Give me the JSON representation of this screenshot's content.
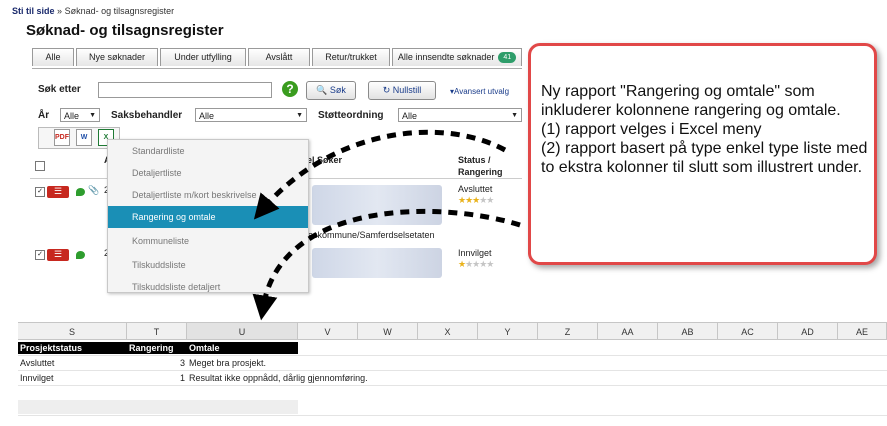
{
  "breadcrumb": {
    "label": "Sti til side",
    "separator": "»",
    "current": "Søknad- og tilsagnsregister"
  },
  "page_title": "Søknad- og tilsagnsregister",
  "tabs": [
    {
      "label": "Alle"
    },
    {
      "label": "Nye søknader"
    },
    {
      "label": "Under utfylling"
    },
    {
      "label": "Avslått"
    },
    {
      "label": "Retur/trukket"
    },
    {
      "label": "Alle innsendte søknader",
      "badge": "41"
    }
  ],
  "search": {
    "label": "Søk etter",
    "value": "",
    "help_icon": "question-icon",
    "search_button": "Søk",
    "reset_button": "Nullstill",
    "advanced_link": "▾Avansert utvalg"
  },
  "filters": {
    "year_label": "År",
    "year_value": "Alle",
    "caseworker_label": "Saksbehandler",
    "caseworker_value": "Alle",
    "support_label": "Støtteordning",
    "support_value": "Alle"
  },
  "export_icons": [
    "pdf-icon",
    "word-icon",
    "excel-icon"
  ],
  "table": {
    "col_a": "A",
    "col_soker": "el Søker",
    "col_status": "Status /",
    "col_rangering": "Rangering",
    "row1_status": "Avsluttet",
    "row1_stars": 3,
    "row1_sub": "eskommune/Samferdselsetaten",
    "row2_status": "Innvilget",
    "row2_stars": 1,
    "row1_id": "2",
    "row2_id": "2"
  },
  "menu": {
    "items": [
      "Standardliste",
      "Detaljertliste",
      "Detaljertliste m/kort beskrivelse",
      "Rangering og omtale",
      "Kommuneliste",
      "Tilskuddsliste",
      "Tilskuddsliste detaljert"
    ],
    "selected_index": 3
  },
  "callout": {
    "text": "Ny rapport \"Rangering og omtale\" som inkluderer kolonnene rangering og omtale.\n(1) rapport velges i Excel meny\n(2) rapport basert på type enkel type liste med to ekstra kolonner til slutt som illustrert under.",
    "border_color": "#e14848"
  },
  "spreadsheet": {
    "columns": [
      "S",
      "T",
      "U",
      "V",
      "W",
      "X",
      "Y",
      "Z",
      "AA",
      "AB",
      "AC",
      "AD",
      "AE"
    ],
    "header": [
      "Prosjektstatus",
      "Rangering",
      "Omtale"
    ],
    "rows": [
      [
        "Avsluttet",
        "3",
        "Meget bra prosjekt."
      ],
      [
        "Innvilget",
        "1",
        "Resultat ikke oppnådd, dårlig gjennomføring."
      ]
    ]
  },
  "colors": {
    "accent": "#1a8fb6",
    "badge": "#2e9d6a",
    "callout_border": "#e14848"
  }
}
